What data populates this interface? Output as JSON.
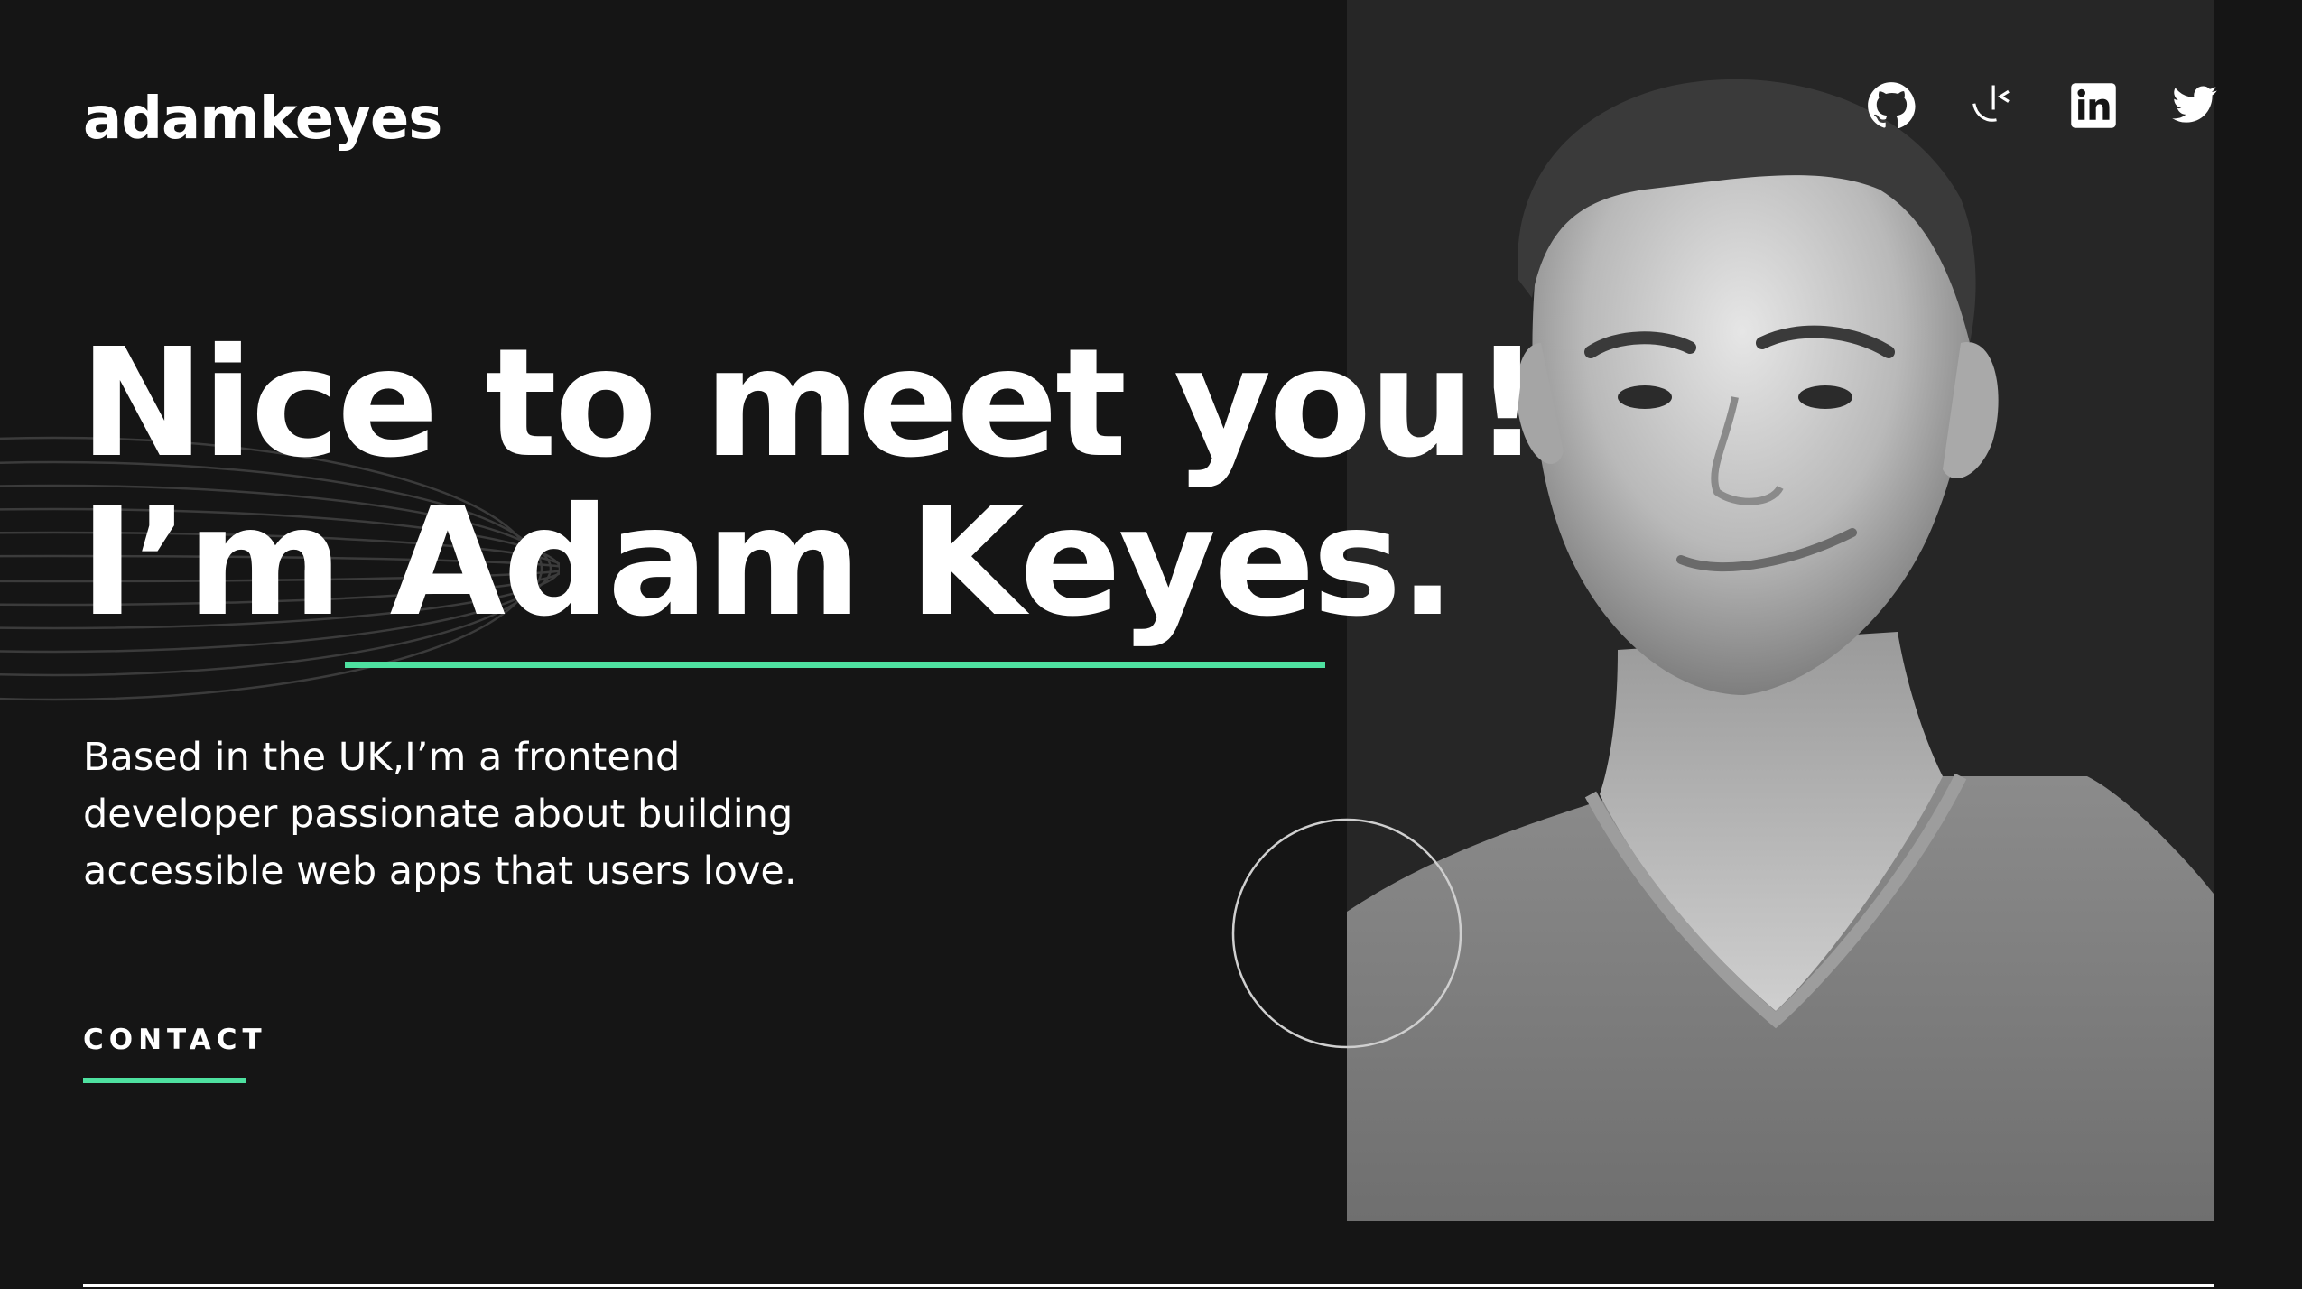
{
  "header": {
    "logo": "adamkeyes"
  },
  "socials": [
    {
      "name": "github-icon"
    },
    {
      "name": "frontend-mentor-icon"
    },
    {
      "name": "linkedin-icon"
    },
    {
      "name": "twitter-icon"
    }
  ],
  "hero": {
    "headline_line1": "Nice to meet you!",
    "headline_line2": "I’m Adam Keyes.",
    "intro": "Based in the UK,I’m a frontend developer passionate about building accessible web apps that users love.",
    "contact_label": "CONTACT"
  },
  "colors": {
    "background": "#151515",
    "panel": "#262626",
    "accent": "#4ee1a0",
    "text": "#ffffff"
  }
}
